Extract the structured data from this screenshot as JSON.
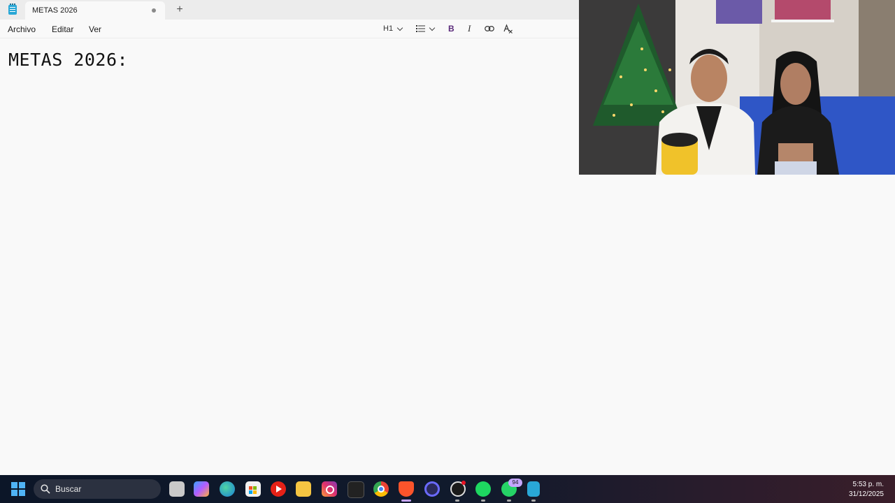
{
  "window": {
    "tab_title": "METAS 2026",
    "new_tab_symbol": "+"
  },
  "menu": {
    "file": "Archivo",
    "edit": "Editar",
    "view": "Ver"
  },
  "toolbar": {
    "heading": "H1",
    "list_icon": "list-icon",
    "bold": "B",
    "italic": "I",
    "link_icon": "link-icon",
    "clear_format_icon": "clear-formatting-icon"
  },
  "editor": {
    "content": "METAS 2026:"
  },
  "taskbar": {
    "search_placeholder": "Buscar",
    "whatsapp_badge": "94",
    "apps": [
      "start-icon",
      "search-icon",
      "task-view-icon",
      "copilot-icon",
      "edge-icon",
      "store-icon",
      "youtube-icon",
      "file-explorer-icon",
      "instagram-icon",
      "epic-games-icon",
      "chrome-icon",
      "brave-icon",
      "cortana-icon",
      "obs-icon",
      "spotify-icon",
      "whatsapp-icon",
      "notepad-icon"
    ],
    "time": "5:53 p. m.",
    "date": "31/12/2025"
  },
  "colors": {
    "accent": "#4fb3f5",
    "editor_bg": "#f9f9f9",
    "taskbar_bg": "#111a2c",
    "bold_purple": "#5a2a7a"
  }
}
